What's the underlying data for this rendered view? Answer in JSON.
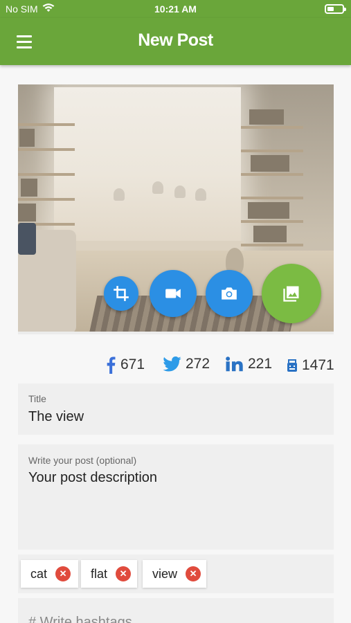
{
  "status_bar": {
    "carrier": "No SIM",
    "wifi_icon": "wifi-icon",
    "time": "10:21 AM",
    "battery_level": 0.45
  },
  "app_bar": {
    "menu_icon": "hamburger-icon",
    "title": "New Post"
  },
  "colors": {
    "primary": "#6aa63a",
    "fab_blue": "#2b8fe4",
    "fab_green": "#7bbb43",
    "chip_remove": "#e04b3d",
    "facebook": "#3b70d9",
    "twitter": "#2d9be8",
    "linkedin": "#2a72c4"
  },
  "photo": {
    "actions": [
      {
        "name": "crop",
        "icon": "crop-icon"
      },
      {
        "name": "video",
        "icon": "videocam-icon"
      },
      {
        "name": "camera",
        "icon": "camera-icon"
      },
      {
        "name": "gallery",
        "icon": "photo-library-icon"
      }
    ]
  },
  "counters": {
    "facebook": "671",
    "twitter": "272",
    "linkedin": "221",
    "total": "1471"
  },
  "form": {
    "title_label": "Title",
    "title_value": "The view",
    "post_label": "Write your post (optional)",
    "post_value": "Your post description",
    "tags": [
      "cat",
      "flat",
      "view"
    ],
    "tags_placeholder": "# Write hashtags"
  }
}
